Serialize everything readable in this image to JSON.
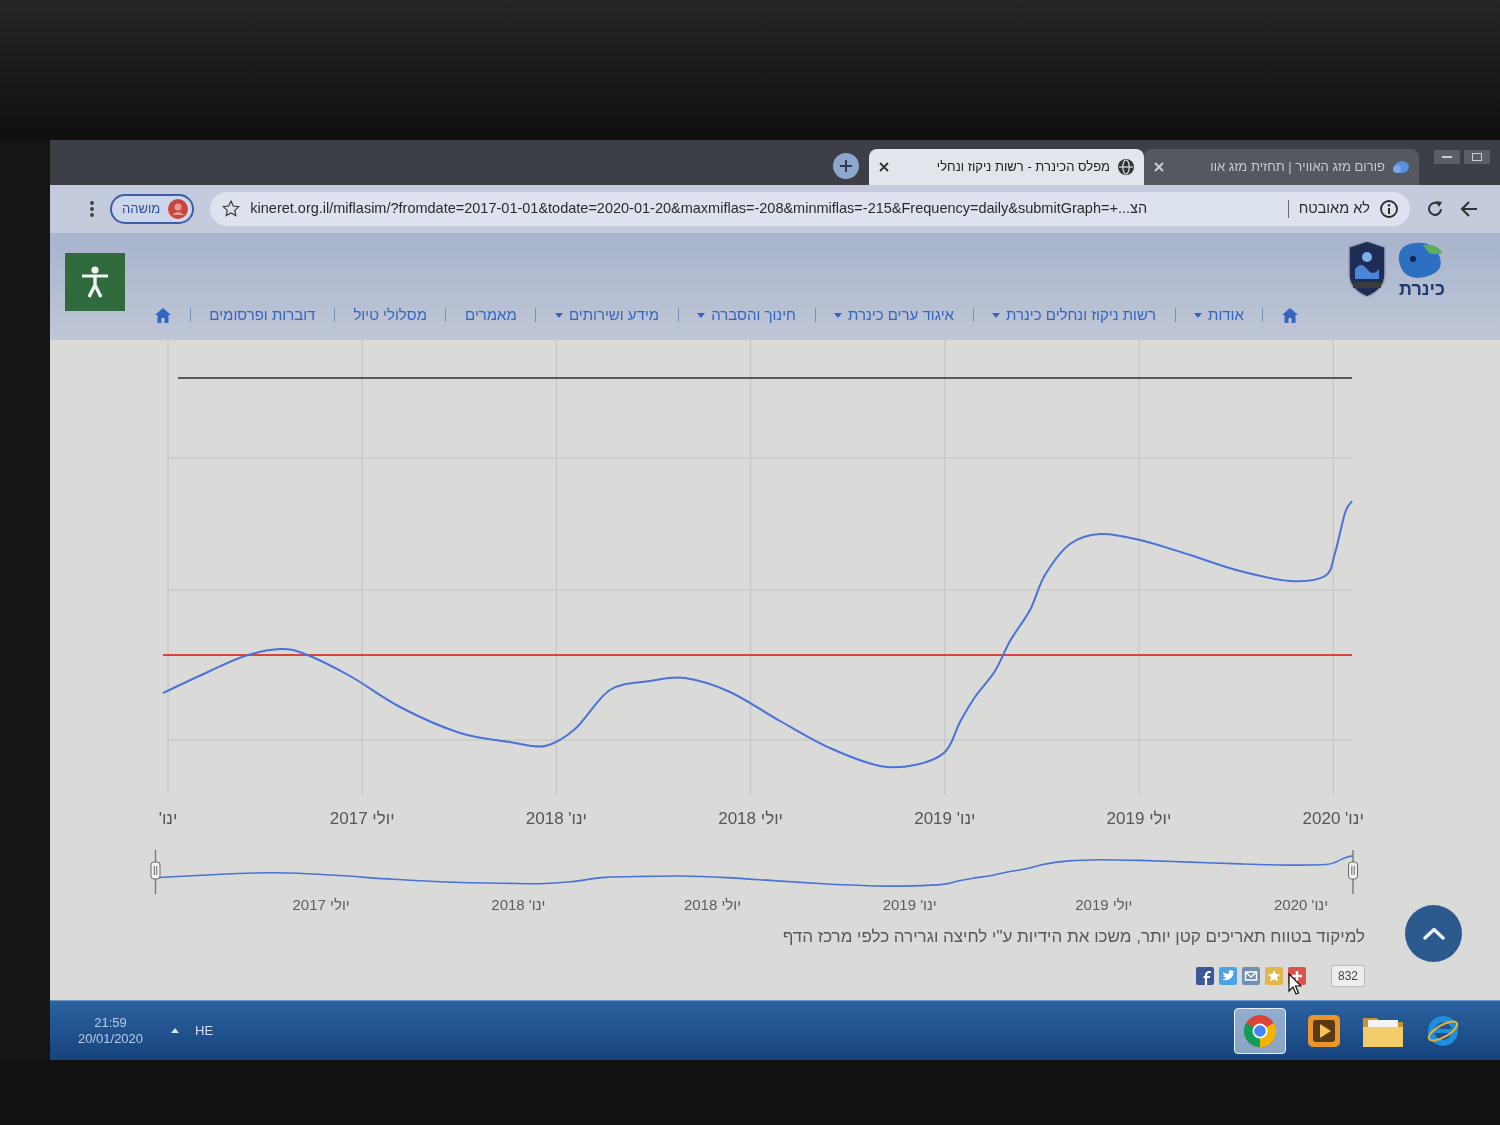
{
  "browser": {
    "tabs": [
      {
        "title": "פורום מזג האוויר | תחזית מזג אוו",
        "selected": false
      },
      {
        "title": "מפלס הכינרת - רשות ניקוז ונחלי",
        "selected": true
      }
    ],
    "profile": {
      "label": "מושהה"
    },
    "address_bar": {
      "url": "kineret.org.il/miflasim/?fromdate=2017-01-01&todate=2020-01-20&maxmiflas=-208&minmiflas=-215&Frequency=daily&submitGraph=+...הצ",
      "security_label": "לא מאובטח"
    }
  },
  "site": {
    "logo": {
      "text": "כינרת"
    },
    "nav": [
      {
        "label": "אודות",
        "dropdown": true
      },
      {
        "label": "רשות ניקוז ונחלים כינרת",
        "dropdown": true
      },
      {
        "label": "איגוד ערים כינרת",
        "dropdown": true
      },
      {
        "label": "חינוך והסברה",
        "dropdown": true
      },
      {
        "label": "מידע ושירותים",
        "dropdown": true
      },
      {
        "label": "מאמרים",
        "dropdown": false
      },
      {
        "label": "מסלולי טיול",
        "dropdown": false
      },
      {
        "label": "דוברות ופרסומים",
        "dropdown": false
      }
    ]
  },
  "chart": {
    "axis_labels": [
      "ינו' 2020",
      "יולי 2019",
      "ינו' 2019",
      "יולי 2018",
      "ינו' 2018",
      "יולי 2017",
      "ינו'"
    ],
    "navigator_labels": [
      "ינו' 2020",
      "יולי 2019",
      "ינו' 2019",
      "יולי 2018",
      "ינו' 2018",
      "יולי 2017"
    ],
    "hint": "למיקוד בטווח תאריכים קטן יותר, משכו את הידיות ע\"י לחיצה וגרירה כלפי מרכז הדף"
  },
  "share": {
    "count": "832"
  },
  "taskbar": {
    "time": "21:59",
    "date": "20/01/2020",
    "language": "HE"
  }
}
